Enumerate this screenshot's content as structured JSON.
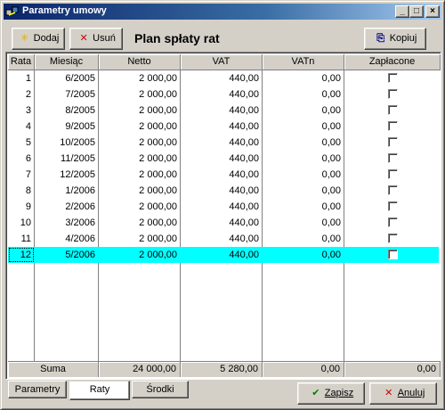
{
  "window": {
    "title": "Parametry umowy"
  },
  "toolbar": {
    "add_label": "Dodaj",
    "delete_label": "Usuń",
    "heading": "Plan spłaty rat",
    "copy_label": "Kopiuj"
  },
  "table": {
    "headers": [
      "Rata",
      "Miesiąc",
      "Netto",
      "VAT",
      "VATn",
      "Zapłacone"
    ],
    "rows": [
      {
        "rata": "1",
        "miesiac": "6/2005",
        "netto": "2 000,00",
        "vat": "440,00",
        "vatn": "0,00",
        "paid": false
      },
      {
        "rata": "2",
        "miesiac": "7/2005",
        "netto": "2 000,00",
        "vat": "440,00",
        "vatn": "0,00",
        "paid": false
      },
      {
        "rata": "3",
        "miesiac": "8/2005",
        "netto": "2 000,00",
        "vat": "440,00",
        "vatn": "0,00",
        "paid": false
      },
      {
        "rata": "4",
        "miesiac": "9/2005",
        "netto": "2 000,00",
        "vat": "440,00",
        "vatn": "0,00",
        "paid": false
      },
      {
        "rata": "5",
        "miesiac": "10/2005",
        "netto": "2 000,00",
        "vat": "440,00",
        "vatn": "0,00",
        "paid": false
      },
      {
        "rata": "6",
        "miesiac": "11/2005",
        "netto": "2 000,00",
        "vat": "440,00",
        "vatn": "0,00",
        "paid": false
      },
      {
        "rata": "7",
        "miesiac": "12/2005",
        "netto": "2 000,00",
        "vat": "440,00",
        "vatn": "0,00",
        "paid": false
      },
      {
        "rata": "8",
        "miesiac": "1/2006",
        "netto": "2 000,00",
        "vat": "440,00",
        "vatn": "0,00",
        "paid": false
      },
      {
        "rata": "9",
        "miesiac": "2/2006",
        "netto": "2 000,00",
        "vat": "440,00",
        "vatn": "0,00",
        "paid": false
      },
      {
        "rata": "10",
        "miesiac": "3/2006",
        "netto": "2 000,00",
        "vat": "440,00",
        "vatn": "0,00",
        "paid": false
      },
      {
        "rata": "11",
        "miesiac": "4/2006",
        "netto": "2 000,00",
        "vat": "440,00",
        "vatn": "0,00",
        "paid": false
      },
      {
        "rata": "12",
        "miesiac": "5/2006",
        "netto": "2 000,00",
        "vat": "440,00",
        "vatn": "0,00",
        "paid": false,
        "selected": true
      }
    ],
    "footer": {
      "label": "Suma",
      "netto": "24 000,00",
      "vat": "5 280,00",
      "vatn": "0,00",
      "paid": "0,00"
    },
    "selected_color": "#00ffff"
  },
  "tabs": [
    {
      "label": "Parametry",
      "active": false
    },
    {
      "label": "Raty",
      "active": true
    },
    {
      "label": "Środki",
      "active": false
    }
  ],
  "actions": {
    "save_label": "Zapisz",
    "cancel_label": "Anuluj"
  },
  "icons": {
    "add": "sparkle-icon",
    "delete": "x-icon",
    "copy": "copy-icon",
    "save": "checkmark-icon",
    "cancel": "x-icon"
  }
}
